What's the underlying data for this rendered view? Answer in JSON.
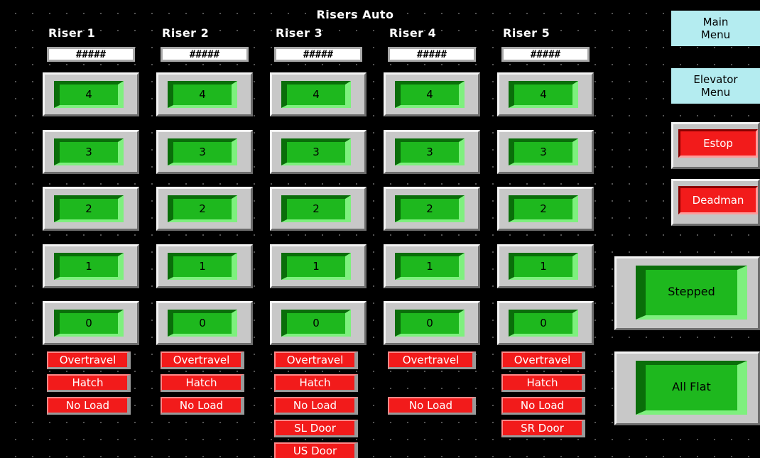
{
  "screen": {
    "title": "Risers Auto"
  },
  "risers": [
    {
      "name": "Riser 1",
      "readout": "#####",
      "levels": [
        "4",
        "3",
        "2",
        "1",
        "0"
      ],
      "statuses": [
        "Overtravel",
        "Hatch",
        "No Load"
      ]
    },
    {
      "name": "Riser 2",
      "readout": "#####",
      "levels": [
        "4",
        "3",
        "2",
        "1",
        "0"
      ],
      "statuses": [
        "Overtravel",
        "Hatch",
        "No Load"
      ]
    },
    {
      "name": "Riser 3",
      "readout": "#####",
      "levels": [
        "4",
        "3",
        "2",
        "1",
        "0"
      ],
      "statuses": [
        "Overtravel",
        "Hatch",
        "No Load",
        "SL Door",
        "US Door"
      ]
    },
    {
      "name": "Riser 4",
      "readout": "#####",
      "levels": [
        "4",
        "3",
        "2",
        "1",
        "0"
      ],
      "statuses": [
        "Overtravel",
        "No Load"
      ]
    },
    {
      "name": "Riser 5",
      "readout": "#####",
      "levels": [
        "4",
        "3",
        "2",
        "1",
        "0"
      ],
      "statuses": [
        "Overtravel",
        "Hatch",
        "No Load",
        "SR Door"
      ]
    }
  ],
  "nav": {
    "main_menu": "Main Menu",
    "elevator_menu": "Elevator Menu",
    "estop": "Estop",
    "deadman": "Deadman"
  },
  "modes": {
    "stepped": "Stepped",
    "all_flat": "All Flat"
  },
  "colors": {
    "background": "#000000",
    "active_green": "#1eb81e",
    "alarm_red": "#f21b1b",
    "menu_cyan": "#b4ecf0",
    "bezel_gray": "#c8c8c8"
  }
}
